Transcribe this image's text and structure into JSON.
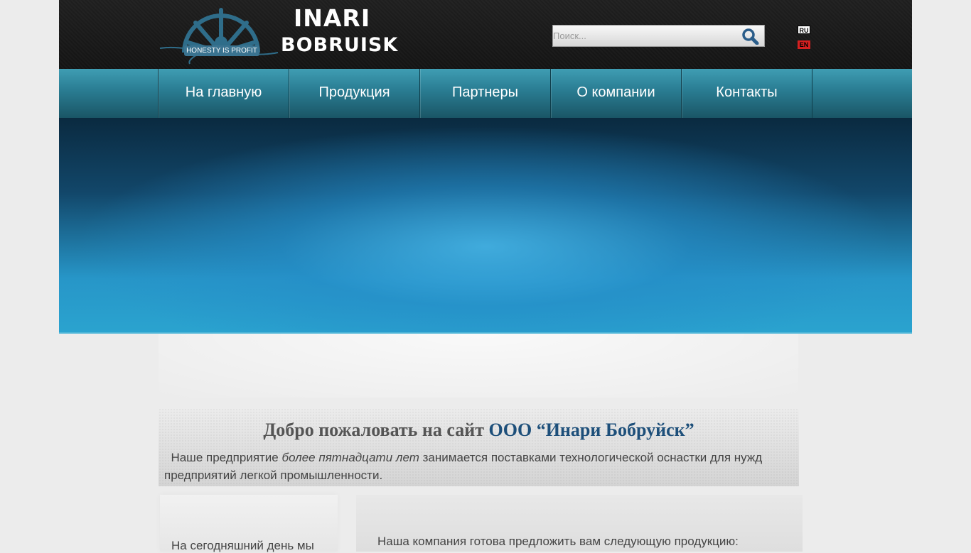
{
  "header": {
    "logo": {
      "line1": "INARI",
      "line2": "BOBRUISK",
      "slogan": "HONESTY IS PROFIT"
    },
    "search": {
      "placeholder": "Поиск...",
      "icon": "search-icon"
    },
    "languages": [
      {
        "code": "RU",
        "color": "#ffffff"
      },
      {
        "code": "EN",
        "color": "#d42020"
      }
    ]
  },
  "nav": {
    "items": [
      {
        "label": "На главную"
      },
      {
        "label": "Продукция"
      },
      {
        "label": "Партнеры"
      },
      {
        "label": "О компании"
      },
      {
        "label": "Контакты"
      }
    ]
  },
  "welcome": {
    "title_prefix": "Добро пожаловать на сайт",
    "title_company": "ООО “Инари Бобруйск”",
    "text_before": "Наше предприятие",
    "text_emphasis": "более пятнадцати лет",
    "text_after": "занимается поставками технологической оснастки для нужд предприятий легкой промышленности."
  },
  "left_box": {
    "text": "На сегодняшний день мы"
  },
  "right_box": {
    "text": "Наша компания готова предложить вам следующую продукцию:"
  },
  "colors": {
    "header_bg": "#181818",
    "nav_bg": "#2b7f95",
    "accent_blue": "#1d4f7a",
    "banner_blue": "#2796c8"
  }
}
